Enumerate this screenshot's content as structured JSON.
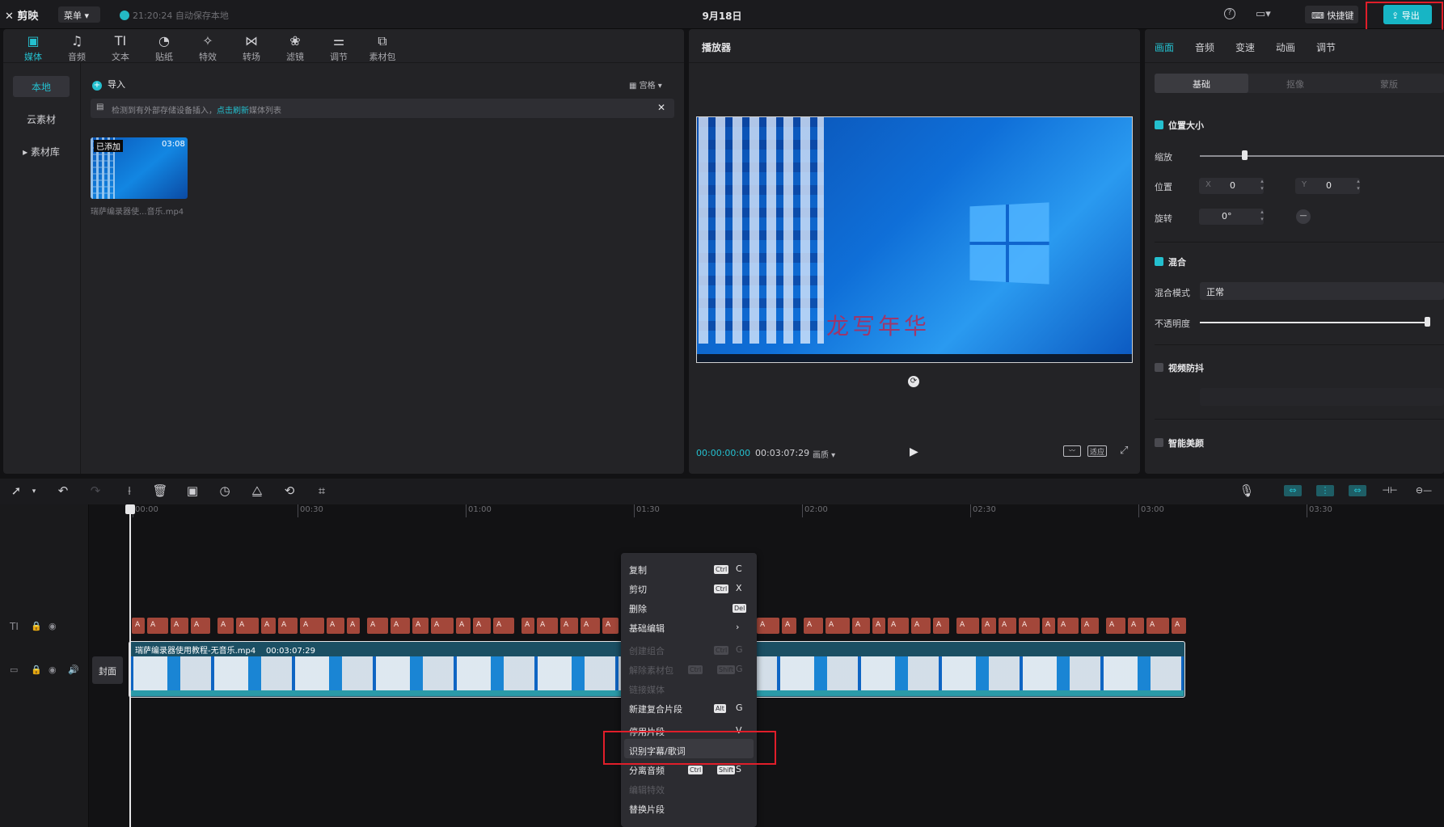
{
  "topbar": {
    "logo": "剪映",
    "menu": "菜单",
    "save_status": "21:20:24 自动保存本地",
    "date": "9月18日",
    "shortcut": "快捷键",
    "export": "导出"
  },
  "media_tabs": [
    {
      "label": "媒体",
      "icon": "▣"
    },
    {
      "label": "音频",
      "icon": "♫"
    },
    {
      "label": "文本",
      "icon": "TI"
    },
    {
      "label": "贴纸",
      "icon": "◔"
    },
    {
      "label": "特效",
      "icon": "✧"
    },
    {
      "label": "转场",
      "icon": "⋈"
    },
    {
      "label": "滤镜",
      "icon": "❀"
    },
    {
      "label": "调节",
      "icon": "⚌"
    },
    {
      "label": "素材包",
      "icon": "⧉"
    }
  ],
  "media_left": {
    "local": "本地",
    "cloud": "云素材",
    "library": "▸ 素材库"
  },
  "media": {
    "import": "导入",
    "sort": "▦ 宫格 ▾",
    "notice_prefix": "检测到有外部存储设备插入，",
    "notice_link": "点击刷新",
    "notice_suffix": "媒体列表",
    "thumb_badge": "已添加",
    "thumb_duration": "03:08",
    "thumb_name": "瑞萨编录器使...音乐.mp4"
  },
  "player": {
    "title": "播放器",
    "watermark": "龙写年华",
    "time_current": "00:00:00:00",
    "time_total": "00:03:07:29",
    "quality": "画质 ▾",
    "fit": "适应"
  },
  "props": {
    "tabs": [
      "画面",
      "音频",
      "变速",
      "动画",
      "调节"
    ],
    "subtabs": [
      "基础",
      "抠像",
      "蒙版"
    ],
    "pos_size": "位置大小",
    "scale": "缩放",
    "position": "位置",
    "pos_x_label": "X",
    "pos_x": "0",
    "pos_y_label": "Y",
    "pos_y": "0",
    "rotate": "旋转",
    "rotate_value": "0°",
    "blend": "混合",
    "blend_mode": "混合模式",
    "blend_mode_value": "正常",
    "opacity": "不透明度",
    "stabilize": "视频防抖",
    "beauty": "智能美颜",
    "scale_level": 0.2,
    "opacity_level": 1.0
  },
  "ruler": [
    "00:00",
    "00:30",
    "01:00",
    "01:30",
    "02:00",
    "02:30",
    "03:00",
    "03:30"
  ],
  "timeline": {
    "cover": "封面",
    "clip_title": "瑞萨编录器使用教程-无音乐.mp4",
    "clip_duration": "00:03:07:29"
  },
  "context_menu": [
    {
      "label": "复制",
      "mod": "Ctrl",
      "key": "C",
      "disabled": false
    },
    {
      "label": "剪切",
      "mod": "Ctrl",
      "key": "X",
      "disabled": false
    },
    {
      "label": "删除",
      "mod": "",
      "key": "Del",
      "disabled": false
    },
    {
      "label": "基础编辑",
      "mod": "",
      "key": "›",
      "disabled": false
    },
    {
      "label": "创建组合",
      "mod": "Ctrl",
      "key": "G",
      "disabled": true
    },
    {
      "label": "解除素材包",
      "mod": "Ctrl Shift",
      "key": "G",
      "disabled": true
    },
    {
      "label": "链接媒体",
      "mod": "",
      "key": "",
      "disabled": true
    },
    {
      "label": "新建复合片段",
      "mod": "Alt",
      "key": "G",
      "disabled": false
    },
    {
      "label": "停用片段",
      "mod": "",
      "key": "V",
      "disabled": false
    },
    {
      "label": "识别字幕/歌词",
      "mod": "",
      "key": "",
      "disabled": false
    },
    {
      "label": "分离音频",
      "mod": "Ctrl Shift",
      "key": "S",
      "disabled": false
    },
    {
      "label": "编辑特效",
      "mod": "",
      "key": "",
      "disabled": true
    },
    {
      "label": "替换片段",
      "mod": "",
      "key": "",
      "disabled": false
    }
  ],
  "caption_glyphs": [
    "A",
    "A",
    "A",
    "A",
    "A",
    "A",
    "A",
    "A"
  ],
  "colors": {
    "accent": "#24c0cf",
    "highlight_box": "#e01e2a",
    "caption": "#a3473a"
  }
}
